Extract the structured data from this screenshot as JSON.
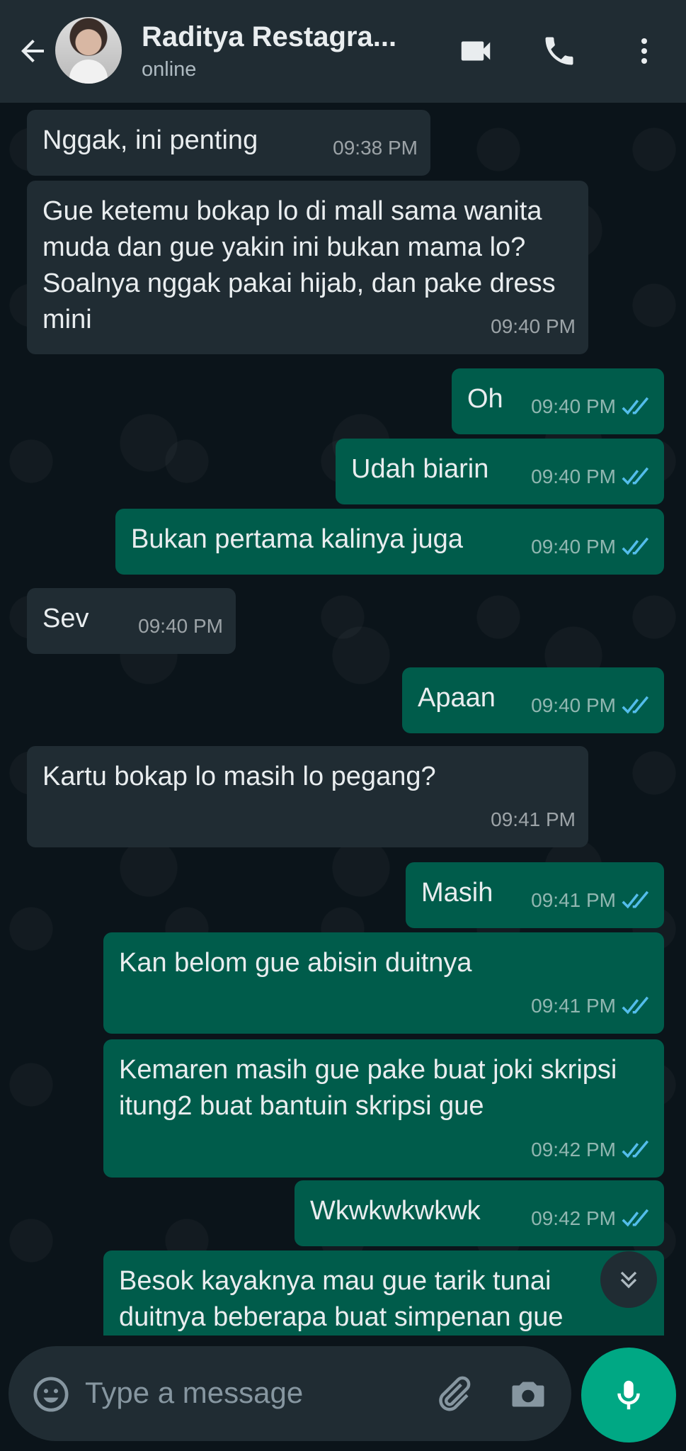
{
  "header": {
    "contact_name": "Raditya Restagra...",
    "status": "online"
  },
  "messages": [
    {
      "dir": "in",
      "text": "Nggak, ini penting",
      "time": "09:38 PM"
    },
    {
      "dir": "in",
      "text": "Gue ketemu bokap lo di mall sama wanita muda dan gue yakin ini bukan mama lo? Soalnya nggak pakai hijab, dan pake dress mini",
      "time": "09:40 PM"
    },
    {
      "dir": "out",
      "text": "Oh",
      "time": "09:40 PM"
    },
    {
      "dir": "out",
      "text": "Udah biarin",
      "time": "09:40 PM"
    },
    {
      "dir": "out",
      "text": "Bukan pertama kalinya juga",
      "time": "09:40 PM"
    },
    {
      "dir": "in",
      "text": "Sev",
      "time": "09:40 PM"
    },
    {
      "dir": "out",
      "text": "Apaan",
      "time": "09:40 PM"
    },
    {
      "dir": "in",
      "text": "Kartu bokap lo masih lo pegang?",
      "time": "09:41 PM"
    },
    {
      "dir": "out",
      "text": "Masih",
      "time": "09:41 PM"
    },
    {
      "dir": "out",
      "text": "Kan belom gue abisin duitnya",
      "time": "09:41 PM"
    },
    {
      "dir": "out",
      "text": "Kemaren masih gue pake buat joki skripsi itung2 buat bantuin skripsi gue",
      "time": "09:42 PM"
    },
    {
      "dir": "out",
      "text": "Wkwkwkwkwk",
      "time": "09:42 PM"
    },
    {
      "dir": "out",
      "text": "Besok kayaknya mau gue tarik tunai duitnya beberapa buat simpenan gue",
      "time": ""
    }
  ],
  "composer": {
    "placeholder": "Type a message"
  },
  "colors": {
    "incoming_bubble": "#202c33",
    "outgoing_bubble": "#005c4b",
    "read_tick": "#53bdeb",
    "accent": "#00a884"
  },
  "icons": [
    "back-arrow-icon",
    "video-call-icon",
    "voice-call-icon",
    "more-options-icon",
    "double-check-icon",
    "chevron-down-icon",
    "emoji-icon",
    "attach-icon",
    "camera-icon",
    "mic-icon"
  ]
}
